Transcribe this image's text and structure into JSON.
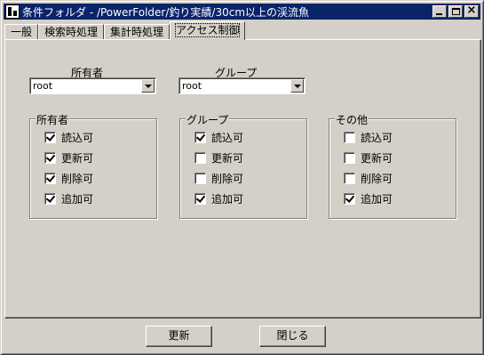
{
  "window": {
    "title": "条件フォルダ - /PowerFolder/釣り実績/30cm以上の渓流魚"
  },
  "tabs": [
    {
      "label": "一般"
    },
    {
      "label": "検索時処理"
    },
    {
      "label": "集計時処理"
    },
    {
      "label": "アクセス制御"
    }
  ],
  "owner_select": {
    "label": "所有者",
    "value": "root"
  },
  "group_select": {
    "label": "グループ",
    "value": "root"
  },
  "permission_groups": [
    {
      "title": "所有者",
      "items": [
        {
          "label": "読込可",
          "checked": true
        },
        {
          "label": "更新可",
          "checked": true
        },
        {
          "label": "削除可",
          "checked": true
        },
        {
          "label": "追加可",
          "checked": true
        }
      ]
    },
    {
      "title": "グループ",
      "items": [
        {
          "label": "読込可",
          "checked": true
        },
        {
          "label": "更新可",
          "checked": false
        },
        {
          "label": "削除可",
          "checked": false
        },
        {
          "label": "追加可",
          "checked": true
        }
      ]
    },
    {
      "title": "その他",
      "items": [
        {
          "label": "読込可",
          "checked": false
        },
        {
          "label": "更新可",
          "checked": false
        },
        {
          "label": "削除可",
          "checked": false
        },
        {
          "label": "追加可",
          "checked": true
        }
      ]
    }
  ],
  "buttons": {
    "update": "更新",
    "close": "閉じる"
  }
}
